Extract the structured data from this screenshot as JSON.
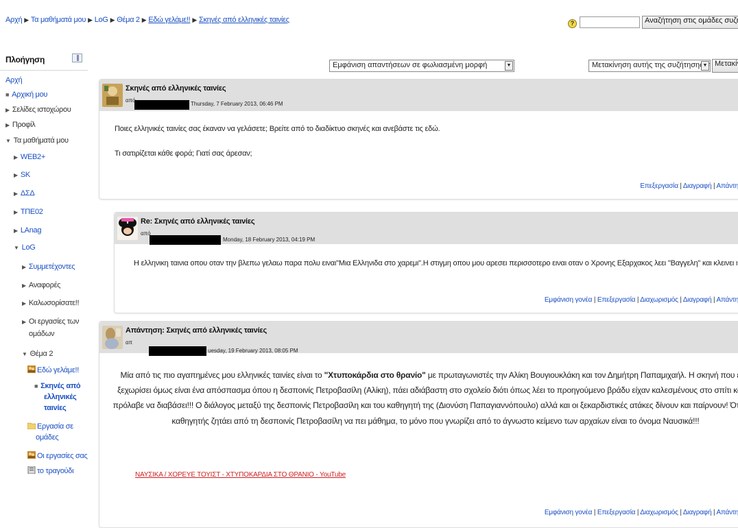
{
  "breadcrumb": {
    "items": [
      "Αρχή",
      "Τα μαθήματά μου",
      "LoG",
      "Θέμα 2",
      "Εδώ γελάμε!!",
      "Σκηνές από ελληνικές ταινίες"
    ],
    "separator": "▶"
  },
  "search": {
    "value": "",
    "button_label": "Αναζήτηση στις ομάδες συζητήσε"
  },
  "navigation": {
    "title": "Πλοήγηση",
    "items": [
      {
        "label": "Αρχή"
      },
      {
        "label": "Αρχική μου"
      },
      {
        "label": "Σελίδες ιστοχώρου"
      },
      {
        "label": "Προφίλ"
      },
      {
        "label": "Τα μαθήματά μου"
      },
      {
        "label": "WEB2+"
      },
      {
        "label": "SK"
      },
      {
        "label": "ΔΣΔ"
      },
      {
        "label": "ΤΠΕ02"
      },
      {
        "label": "LAnag"
      },
      {
        "label": "LoG"
      },
      {
        "label": "Συμμετέχοντες"
      },
      {
        "label": "Αναφορές"
      },
      {
        "label": "Καλωσορίσατε!!"
      },
      {
        "label": "Οι εργασίες των"
      },
      {
        "label": "ομάδων"
      },
      {
        "label": "Θέμα 2"
      },
      {
        "label": "Εδώ γελάμε!!"
      },
      {
        "label": "Σκηνές από"
      },
      {
        "label": "ελληνικές"
      },
      {
        "label": "ταινίες"
      },
      {
        "label": "Εργασία σε"
      },
      {
        "label": "ομάδες"
      },
      {
        "label": "Οι εργασίες σας"
      },
      {
        "label": "το τραγούδι"
      }
    ]
  },
  "toolbar": {
    "display_mode": "Εμφάνιση απαντήσεων σε φωλιασμένη μορφή",
    "move_select": "Μετακίνηση αυτής της συζήτησης στο...",
    "move_button": "Μετακίνηση"
  },
  "posts": [
    {
      "subject": "Σκηνές από ελληνικές ταινίες",
      "by": "από",
      "date": "Thursday, 7 February 2013, 06:46 PM",
      "paragraphs": [
        "Ποιες ελληνικές ταινίες σας έκαναν να γελάσετε; Βρείτε από το διαδίκτυο σκηνές και ανεβάστε τις εδώ.",
        "Τι σατιρίζεται κάθε φορά; Γιατί σας άρεσαν;"
      ],
      "commands": [
        "Επεξεργασία",
        "Διαγραφή",
        "Απάντη"
      ]
    },
    {
      "subject": "Re: Σκηνές από ελληνικές ταινίες",
      "by": "από",
      "date": "Monday, 18 February 2013, 04:19 PM",
      "paragraphs": [
        "Η ελληνικη ταινια οπου οταν την βλεπω γελαω παρα πολυ ειναι\"Μια Ελληνιδα στο χαρεμι\".Η στιγμη οπου μου αρεσει περισσοτερο ειναι οταν ο Χρονης Εξαρχακος λεει \"Βαγγελη\" και κλεινει η πορτα."
      ],
      "commands": [
        "Εμφάνιση γονέα",
        "Επεξεργασία",
        "Διαχωρισμός",
        "Διαγραφή",
        "Απάντη"
      ]
    },
    {
      "subject": "Απάντηση: Σκηνές από ελληνικές ταινίες",
      "by": "απ",
      "date": "uesday, 19 February 2013, 08:05 PM",
      "lines": [
        {
          "pre": "Μία από τις πιο αγαπημένες μου ελληνικές ταινίες είναι το ",
          "bold": "\"Χτυποκάρδια στο θρανίο\"",
          "post": " με πρωταγωνιστές την Αλίκη Βουγιουκλάκη και τον Δημήτρη Παπαμιχαήλ. Η σκηνή που έχω"
        },
        {
          "pre": "ξεχωρίσει όμως είναι ένα απόσπασμα όπου η δεσποινίς Πετροβασίλη (Αλίκη), πάει αδιάβαστη στο σχολείο διότι όπως λέει το προηγούμενο βράδυ είχαν καλεσμένους στο σπίτι και δε"
        },
        {
          "pre": "πρόλαβε να διαβάσει!!! Ο διάλογος μεταξύ της δεσποινίς Πετροβασίλη και του καθηγητή της (Διονύση Παπαγιαννόπουλο) αλλά και οι ξεκαρδιστικές ατάκες δίνουν και παίρνουν! Όταν δε"
        },
        {
          "pre": "καθηγητής ζητάει από τη δεσποινίς Πετροβασίλη να πει μάθημα, το μόνο που γνωρίζει από το άγνωστο κείμενο των αρχαίων είναι το όνομα Ναυσικά!!!"
        }
      ],
      "link": "ΝΑΥΣΙΚΑ / ΧΟΡΕΥΕ ΤΟΥΙΣΤ - ΧΤΥΠΟΚΑΡΔΙΑ ΣΤΟ ΘΡΑΝΙΟ - YouTube",
      "commands": [
        "Εμφάνιση γονέα",
        "Επεξεργασία",
        "Διαχωρισμός",
        "Διαγραφή",
        "Απάντη"
      ]
    }
  ],
  "colors": {
    "link": "#1a4fc2",
    "header_bg": "#dfdfdf",
    "video_link": "#cc2222"
  }
}
